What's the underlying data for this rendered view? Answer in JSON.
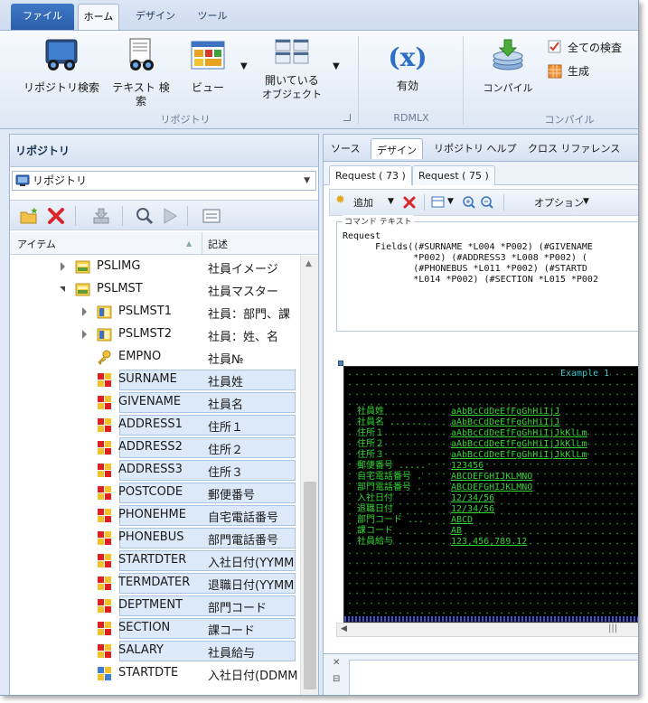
{
  "ribbon": {
    "tabs": [
      "ファイル",
      "ホーム",
      "デザイン",
      "ツール"
    ],
    "buttons": {
      "repo_search": "リポジトリ検索",
      "text_search": "テキスト 検索",
      "view": "ビュー",
      "open_objects_line1": "開いている",
      "open_objects_line2": "オブジェクト",
      "enable": "有効",
      "compile": "コンパイル",
      "check_all": "全ての検査",
      "generate": "生成"
    },
    "groups": [
      "リポジトリ",
      "RDMLX",
      "コンパイル"
    ]
  },
  "left_pane": {
    "title": "リポジトリ",
    "combo_value": "リポジトリ",
    "columns": [
      "アイテム",
      "記述"
    ],
    "rows": [
      {
        "name": "PSLIMG",
        "desc": "社員イメージ"
      },
      {
        "name": "PSLMST",
        "desc": "社員マスター"
      },
      {
        "name": "PSLMST1",
        "desc": "社員：部門、課"
      },
      {
        "name": "PSLMST2",
        "desc": "社員：姓、名"
      },
      {
        "name": "EMPNO",
        "desc": "社員№"
      },
      {
        "name": "SURNAME",
        "desc": "社員姓"
      },
      {
        "name": "GIVENAME",
        "desc": "社員名"
      },
      {
        "name": "ADDRESS1",
        "desc": "住所１"
      },
      {
        "name": "ADDRESS2",
        "desc": "住所２"
      },
      {
        "name": "ADDRESS3",
        "desc": "住所３"
      },
      {
        "name": "POSTCODE",
        "desc": "郵便番号"
      },
      {
        "name": "PHONEHME",
        "desc": "自宅電話番号"
      },
      {
        "name": "PHONEBUS",
        "desc": "部門電話番号"
      },
      {
        "name": "STARTDTER",
        "desc": "入社日付(YYMM"
      },
      {
        "name": "TERMDATER",
        "desc": "退職日付(YYMM"
      },
      {
        "name": "DEPTMENT",
        "desc": "部門コード"
      },
      {
        "name": "SECTION",
        "desc": "課コード"
      },
      {
        "name": "SALARY",
        "desc": "社員給与"
      },
      {
        "name": "STARTDTE",
        "desc": "入社日付(DDMM"
      }
    ]
  },
  "right_pane": {
    "tabs": [
      "ソース",
      "デザイン",
      "リポジトリ ヘルプ",
      "クロス リファレンス"
    ],
    "subtabs": [
      "Request ( 73 )",
      "Request ( 75 )"
    ],
    "toolbar": {
      "add": "追加",
      "options": "オプション"
    },
    "command_legend": "コマンド テキスト",
    "command_text": "Request\n      Fields((#SURNAME *L004 *P002) (#GIVENAME\n             *P002) (#ADDRESS3 *L008 *P002) (\n             (#PHONEBUS *L011 *P002) (#STARTD\n             *L014 *P002) (#SECTION *L015 *P002",
    "screen": {
      "title": "Example 1",
      "rows": [
        {
          "label": "社員姓",
          "value": "aAbBcCdDeEfFgGhHiIjJ"
        },
        {
          "label": "社員名 .......",
          "value": "aAbBcCdDeEfFgGhHiIjJ"
        },
        {
          "label": "住所１",
          "value": "aAbBcCdDeEfFgGhHiIjJkKlLm"
        },
        {
          "label": "住所２",
          "value": "aAbBcCdDeEfFgGhHiIjJkKlLm"
        },
        {
          "label": "住所３",
          "value": "aAbBcCdDeEfFgGhHiIjJkKlLm"
        },
        {
          "label": "郵便番号 .....",
          "value": "123456"
        },
        {
          "label": "自宅電話番号 .",
          "value": "ABCDEFGHIJKLMNO"
        },
        {
          "label": "部門電話番号 .",
          "value": "ABCDEFGHIJKLMNO"
        },
        {
          "label": "入社日付",
          "value": "12/34/56"
        },
        {
          "label": "退職日付",
          "value": "12/34/56"
        },
        {
          "label": "部門コード ...",
          "value": "ABCD"
        },
        {
          "label": "課コード",
          "value": "AB"
        },
        {
          "label": "社員給与",
          "value": "123,456,789.12"
        }
      ]
    }
  }
}
